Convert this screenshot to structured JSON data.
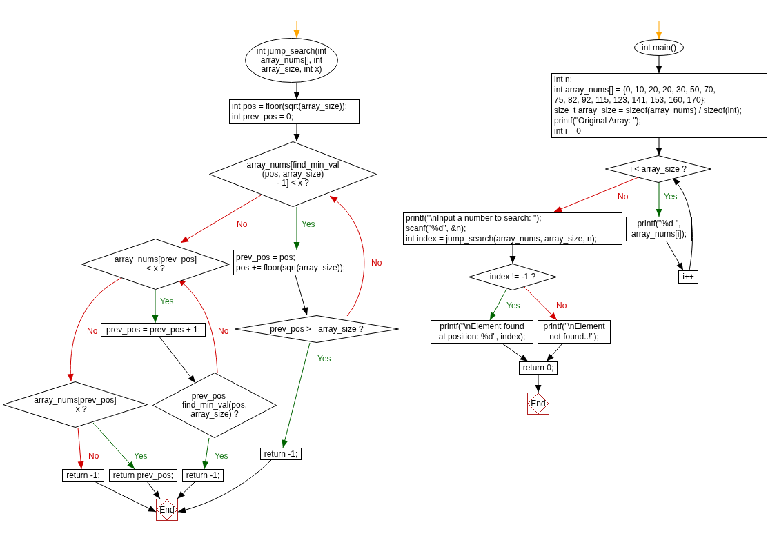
{
  "flowchart": {
    "nodes": [
      {
        "kind": "start",
        "lines": [
          "int jump_search(int",
          "array_nums[], int",
          "array_size, int x)"
        ]
      },
      {
        "kind": "process",
        "lines": [
          "int pos = floor(sqrt(array_size));",
          "int prev_pos = 0;"
        ]
      },
      {
        "kind": "decision",
        "lines": [
          "array_nums[find_min_val",
          "(pos, array_size)",
          "- 1] < x ?"
        ]
      },
      {
        "kind": "decision",
        "lines": [
          "array_nums[prev_pos]",
          "< x ?"
        ]
      },
      {
        "kind": "process",
        "lines": [
          "prev_pos = pos;",
          "pos += floor(sqrt(array_size));"
        ]
      },
      {
        "kind": "process",
        "lines": [
          "prev_pos = prev_pos + 1;"
        ]
      },
      {
        "kind": "decision",
        "lines": [
          "prev_pos >= array_size ?"
        ]
      },
      {
        "kind": "decision",
        "lines": [
          "array_nums[prev_pos]",
          "== x ?"
        ]
      },
      {
        "kind": "decision",
        "lines": [
          "prev_pos ==",
          "find_min_val(pos,",
          "array_size) ?"
        ]
      },
      {
        "kind": "process",
        "lines": [
          "return -1;"
        ]
      },
      {
        "kind": "process",
        "lines": [
          "return prev_pos;"
        ]
      },
      {
        "kind": "process",
        "lines": [
          "return -1;"
        ]
      },
      {
        "kind": "process",
        "lines": [
          "return -1;"
        ]
      },
      {
        "kind": "end",
        "lines": [
          "End"
        ]
      },
      {
        "kind": "start",
        "lines": [
          "int main()"
        ]
      },
      {
        "kind": "process",
        "lines": [
          "int n;",
          "int array_nums[] = {0, 10, 20, 20, 30, 50, 70,",
          "75, 82, 92, 115, 123, 141, 153, 160, 170};",
          "size_t array_size = sizeof(array_nums) / sizeof(int);",
          "printf(\"Original Array: \");",
          "int i = 0"
        ]
      },
      {
        "kind": "decision",
        "lines": [
          "i < array_size ?"
        ]
      },
      {
        "kind": "process",
        "lines": [
          "printf(\"\\nInput a number to search: \");",
          "scanf(\"%d\", &n);",
          "int index = jump_search(array_nums, array_size, n);"
        ]
      },
      {
        "kind": "process",
        "lines": [
          "printf(\"%d \",",
          "array_nums[i]);"
        ]
      },
      {
        "kind": "process",
        "lines": [
          "i++"
        ]
      },
      {
        "kind": "decision",
        "lines": [
          "index != -1 ?"
        ]
      },
      {
        "kind": "process",
        "lines": [
          "printf(\"\\nElement found",
          "at position: %d\", index);"
        ]
      },
      {
        "kind": "process",
        "lines": [
          "printf(\"\\nElement",
          "not found..!\");"
        ]
      },
      {
        "kind": "process",
        "lines": [
          "return 0;"
        ]
      },
      {
        "kind": "end",
        "lines": [
          "End"
        ]
      }
    ],
    "edges": [
      {
        "kind": "entry"
      },
      {
        "kind": "plain"
      },
      {
        "kind": "plain"
      },
      {
        "kind": "no",
        "label": "No"
      },
      {
        "kind": "yes",
        "label": "Yes"
      },
      {
        "kind": "no",
        "label": "No"
      },
      {
        "kind": "yes",
        "label": "Yes"
      },
      {
        "kind": "no",
        "label": "No"
      },
      {
        "kind": "no",
        "label": "No"
      },
      {
        "kind": "plain"
      },
      {
        "kind": "plain"
      },
      {
        "kind": "yes",
        "label": "Yes"
      },
      {
        "kind": "no",
        "label": "No"
      },
      {
        "kind": "yes",
        "label": "Yes"
      },
      {
        "kind": "yes",
        "label": "Yes"
      },
      {
        "kind": "plain"
      },
      {
        "kind": "plain"
      },
      {
        "kind": "plain"
      },
      {
        "kind": "plain"
      },
      {
        "kind": "entry"
      },
      {
        "kind": "plain"
      },
      {
        "kind": "plain"
      },
      {
        "kind": "no",
        "label": "No"
      },
      {
        "kind": "yes",
        "label": "Yes"
      },
      {
        "kind": "plain"
      },
      {
        "kind": "plain"
      },
      {
        "kind": "plain"
      },
      {
        "kind": "yes",
        "label": "Yes"
      },
      {
        "kind": "no",
        "label": "No"
      },
      {
        "kind": "plain"
      },
      {
        "kind": "plain"
      },
      {
        "kind": "plain"
      }
    ]
  }
}
